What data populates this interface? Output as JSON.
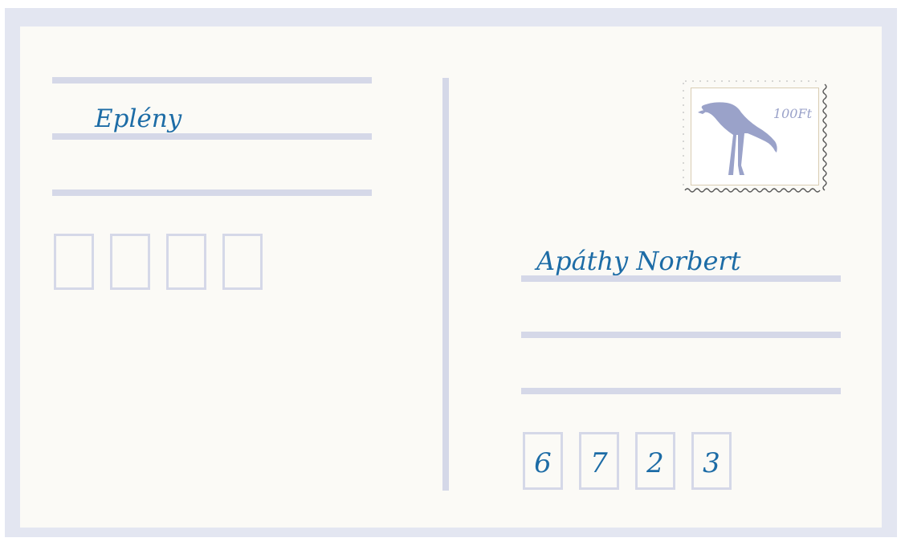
{
  "postcard": {
    "sender_line": "Eplény",
    "recipient_name": "Apáthy Norbert",
    "recipient_zip_digits": [
      "6",
      "7",
      "2",
      "3"
    ],
    "sender_zip_digits": [
      "",
      "",
      "",
      ""
    ]
  },
  "stamp": {
    "value": "100Ft",
    "image": "crane-bird-icon"
  },
  "colors": {
    "frame": "#e3e6f1",
    "card": "#fbfaf6",
    "lines": "#d5d8e8",
    "ink": "#1d6ca6",
    "stamp_art": "#9aa2c9"
  }
}
